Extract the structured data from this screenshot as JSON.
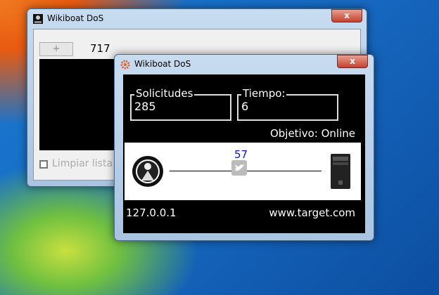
{
  "back_window": {
    "title": "Wikiboat DoS",
    "close": "x",
    "plus_label": "+",
    "count": "717",
    "checkbox_label": "Limpiar lista"
  },
  "front_window": {
    "title": "Wikiboat DoS",
    "close": "x",
    "requests_label": "Solicitudes",
    "requests_value": "285",
    "time_label": "Tiempo:",
    "time_value": "6",
    "target_status": "Objetivo: Online",
    "packet_count": "57",
    "source_ip": "127.0.0.1",
    "target_url": "www.target.com"
  },
  "colors": {
    "packet_count": "#1010e0",
    "close_button": "#c84030"
  }
}
